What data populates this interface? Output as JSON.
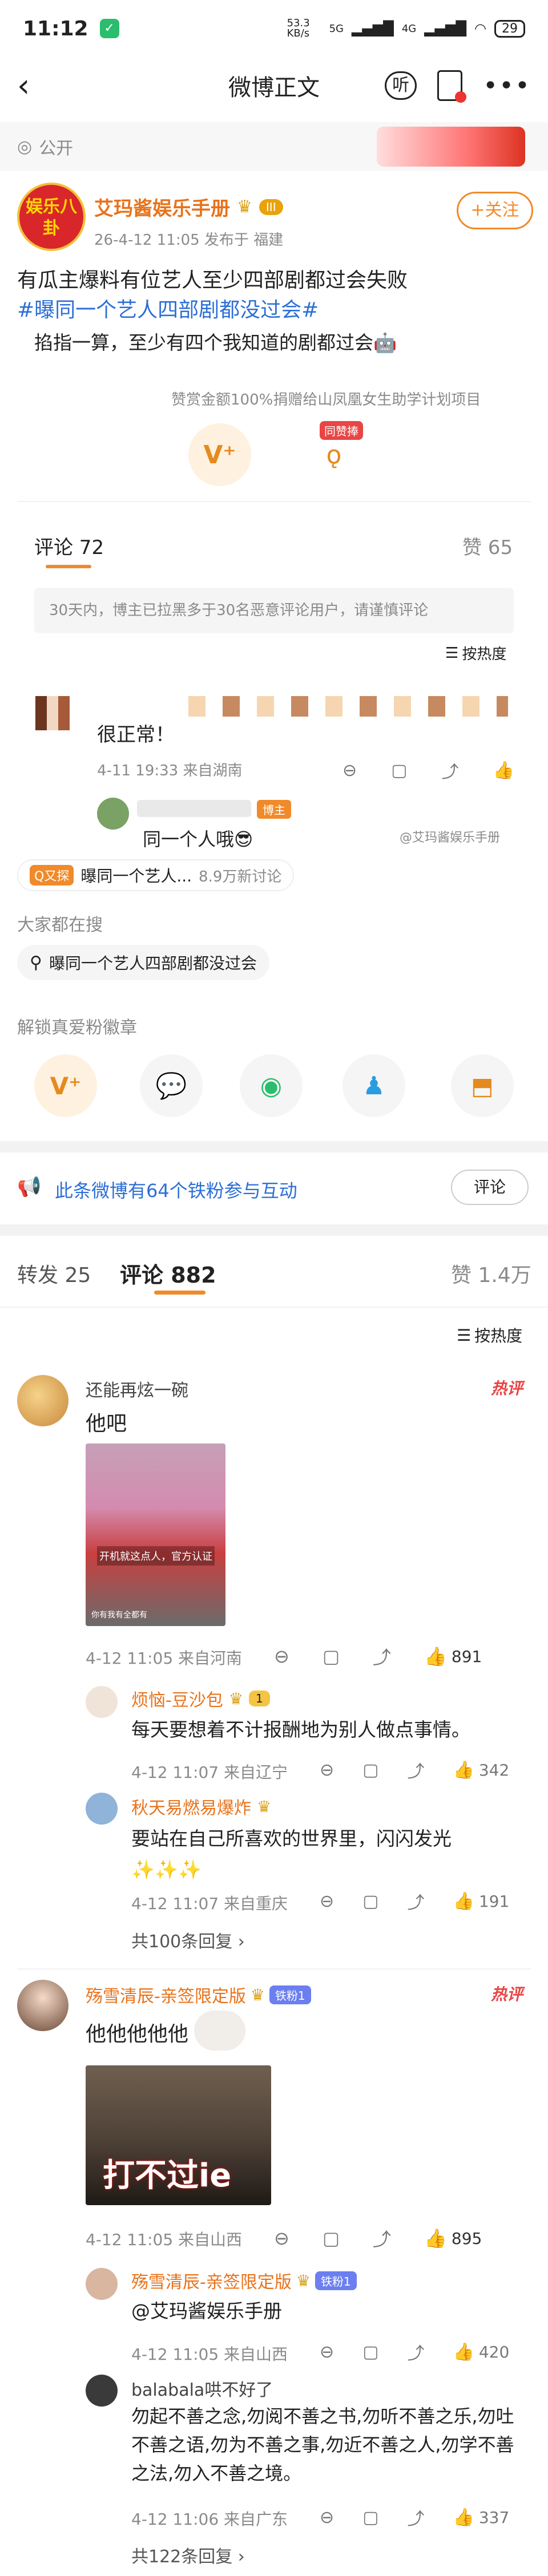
{
  "status_bar": {
    "time": "11:12",
    "speed": "53.3 KB/s",
    "network": "5G",
    "network2": "4G",
    "battery": "29"
  },
  "nav": {
    "title": "微博正文",
    "listen_label": "听"
  },
  "visibility": "公开",
  "post": {
    "author": "艾玛酱娱乐手册",
    "level": "III",
    "time_loc": "26-4-12 11:05  发布于 福建",
    "follow_label": "+关注",
    "avatar_text": "娱乐八卦",
    "line1": "有瓜主爆料有位艺人至少四部剧都过会失败",
    "line2": "#曝同一个艺人四部剧都没过会#",
    "line3": "掐指一算，至少有四个我知道的剧都过会🤖",
    "donation": "赞赏金额100%捐赠给山凤凰女生助学计划项目",
    "reward_tag": "同赞捧"
  },
  "inner_stats": {
    "comments_label": "评论 72",
    "likes_label": "赞 65",
    "notice": "30天内，博主已拉黑多于30名恶意评论用户，请谨慎评论",
    "sort_label": "按热度"
  },
  "inner_comment": {
    "text": "很正常！",
    "meta": "4-11 19:33  来自湖南",
    "reply_text": "同一个人哦😎",
    "reply_badge": "博主",
    "watermark": "@艾玛酱娱乐手册"
  },
  "topic_chip": {
    "badge": "Q又探",
    "title": "曝同一个艺人...",
    "count": "8.9万新讨论"
  },
  "search_section": {
    "label": "大家都在搜",
    "query": "曝同一个艺人四部剧都没过会"
  },
  "fan_badge_section": {
    "label": "解锁真爱粉徽章"
  },
  "iron_fans": {
    "text": "此条微博有64个铁粉参与互动",
    "comment_button": "评论"
  },
  "tabs": {
    "repost": "转发 25",
    "comment": "评论 882",
    "like": "赞 1.4万",
    "sort": "按热度"
  },
  "comments": [
    {
      "user": "还能再炫一碗",
      "text": "他吧",
      "hot": "热评",
      "image_caption": "你有我有全都有",
      "image_caption2": "开机就这点人，官方认证",
      "meta": "4-12 11:05  来自河南",
      "likes": "891",
      "replies": [
        {
          "user": "烦恼-豆沙包",
          "badge": "1",
          "text": "每天要想着不计报酬地为别人做点事情。",
          "meta": "4-12 11:07  来自辽宁",
          "likes": "342"
        },
        {
          "user": "秋天易燃易爆炸",
          "badge": "",
          "text": "要站在自己所喜欢的世界里，闪闪发光✨✨✨",
          "meta": "4-12 11:07  来自重庆",
          "likes": "191"
        }
      ],
      "more": "共100条回复 ›"
    },
    {
      "user": "殇雪清辰-亲签限定版",
      "badge": "铁粉1",
      "text": "他他他他他",
      "hot": "热评",
      "image_caption": "打不过ie",
      "meta": "4-12 11:05  来自山西",
      "likes": "895",
      "replies": [
        {
          "user": "殇雪清辰-亲签限定版",
          "badge": "铁粉1",
          "text": "@艾玛酱娱乐手册",
          "meta": "4-12 11:05  来自山西",
          "likes": "420"
        },
        {
          "user": "balabala哄不好了",
          "badge": "",
          "text": "勿起不善之念,勿阅不善之书,勿听不善之乐,勿吐不善之语,勿为不善之事,勿近不善之人,勿学不善之法,勿入不善之境。",
          "meta": "4-12 11:06  来自广东",
          "likes": "337"
        }
      ],
      "more": "共122条回复 ›"
    }
  ]
}
